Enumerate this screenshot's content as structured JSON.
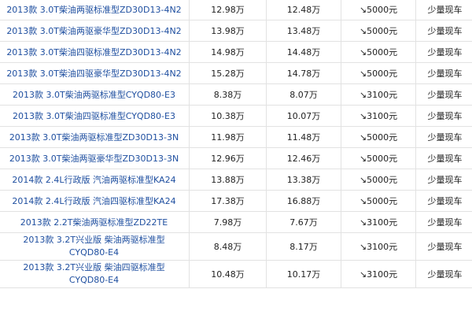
{
  "rows": [
    {
      "model": "2013款 3.0T柴油两驱标准型ZD30D13-4N2",
      "guide_price": "12.98万",
      "deal_price": "12.48万",
      "discount": "↘5000元",
      "stock": "少量现车",
      "two_line": false
    },
    {
      "model": "2013款 3.0T柴油两驱豪华型ZD30D13-4N2",
      "guide_price": "13.98万",
      "deal_price": "13.48万",
      "discount": "↘5000元",
      "stock": "少量现车",
      "two_line": false
    },
    {
      "model": "2013款 3.0T柴油四驱标准型ZD30D13-4N2",
      "guide_price": "14.98万",
      "deal_price": "14.48万",
      "discount": "↘5000元",
      "stock": "少量现车",
      "two_line": false
    },
    {
      "model": "2013款 3.0T柴油四驱豪华型ZD30D13-4N2",
      "guide_price": "15.28万",
      "deal_price": "14.78万",
      "discount": "↘5000元",
      "stock": "少量现车",
      "two_line": false
    },
    {
      "model": "2013款 3.0T柴油两驱标准型CYQD80-E3",
      "guide_price": "8.38万",
      "deal_price": "8.07万",
      "discount": "↘3100元",
      "stock": "少量现车",
      "two_line": false
    },
    {
      "model": "2013款 3.0T柴油四驱标准型CYQD80-E3",
      "guide_price": "10.38万",
      "deal_price": "10.07万",
      "discount": "↘3100元",
      "stock": "少量现车",
      "two_line": false
    },
    {
      "model": "2013款 3.0T柴油两驱标准型ZD30D13-3N",
      "guide_price": "11.98万",
      "deal_price": "11.48万",
      "discount": "↘5000元",
      "stock": "少量现车",
      "two_line": false
    },
    {
      "model": "2013款 3.0T柴油两驱豪华型ZD30D13-3N",
      "guide_price": "12.96万",
      "deal_price": "12.46万",
      "discount": "↘5000元",
      "stock": "少量现车",
      "two_line": false
    },
    {
      "model": "2014款 2.4L行政版 汽油两驱标准型KA24",
      "guide_price": "13.88万",
      "deal_price": "13.38万",
      "discount": "↘5000元",
      "stock": "少量现车",
      "two_line": false
    },
    {
      "model": "2014款 2.4L行政版 汽油四驱标准型KA24",
      "guide_price": "17.38万",
      "deal_price": "16.88万",
      "discount": "↘5000元",
      "stock": "少量现车",
      "two_line": false
    },
    {
      "model": "2013款 2.2T柴油两驱标准型ZD22TE",
      "guide_price": "7.98万",
      "deal_price": "7.67万",
      "discount": "↘3100元",
      "stock": "少量现车",
      "two_line": false
    },
    {
      "model": "2013款 3.2T兴业版 柴油两驱标准型 CYQD80-E4",
      "model_line1": "2013款 3.2T兴业版 柴油两驱标准型",
      "model_line2": "CYQD80-E4",
      "guide_price": "8.48万",
      "deal_price": "8.17万",
      "discount": "↘3100元",
      "stock": "少量现车",
      "two_line": true
    },
    {
      "model": "2013款 3.2T兴业版 柴油四驱标准型 CYQD80-E4",
      "model_line1": "2013款 3.2T兴业版 柴油四驱标准型",
      "model_line2": "CYQD80-E4",
      "guide_price": "10.48万",
      "deal_price": "10.17万",
      "discount": "↘3100元",
      "stock": "少量现车",
      "two_line": true
    }
  ],
  "colors": {
    "link": "#1f4fa0",
    "text": "#222222",
    "border": "#e2e2e2"
  }
}
